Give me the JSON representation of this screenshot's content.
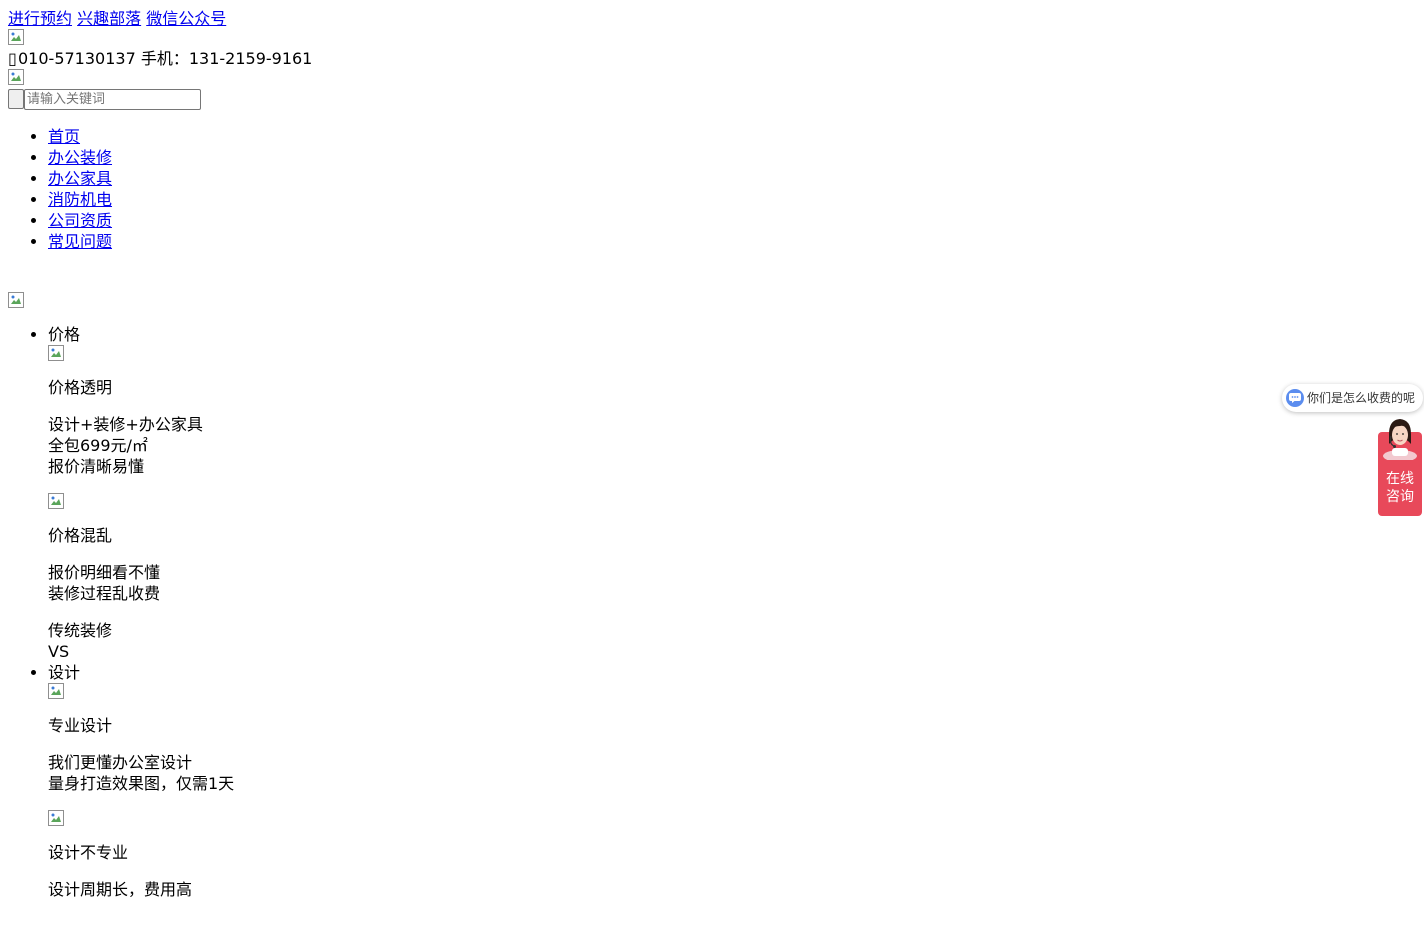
{
  "header": {
    "top_links": [
      "进行预约",
      "兴趣部落",
      "微信公众号"
    ],
    "phone_icon": "phone-icon",
    "phone_text": "010-57130137 手机：131-2159-9161"
  },
  "search": {
    "placeholder": "请输入关键词"
  },
  "nav": {
    "items": [
      "首页",
      "办公装修",
      "办公家具",
      "消防机电",
      "公司资质",
      "常见问题"
    ]
  },
  "compare": [
    {
      "tab": "价格",
      "good_title": "价格透明",
      "good_lines": [
        "设计+装修+办公家具",
        "全包699元/㎡",
        "报价清晰易懂"
      ],
      "bad_title": "价格混乱",
      "bad_lines": [
        "报价明细看不懂",
        "装修过程乱收费"
      ],
      "traditional_label": "传统装修",
      "vs_label": "VS"
    },
    {
      "tab": "设计",
      "good_title": "专业设计",
      "good_lines": [
        "我们更懂办公室设计",
        "量身打造效果图，仅需1天"
      ],
      "bad_title": "设计不专业",
      "bad_lines": [
        "设计周期长，费用高"
      ]
    }
  ],
  "chat_widget": {
    "bubble_text": "你们是怎么收费的呢",
    "consult_line1": "在线",
    "consult_line2": "咨询",
    "accent_color": "#e8495a",
    "bubble_icon_color": "#5b8def"
  }
}
